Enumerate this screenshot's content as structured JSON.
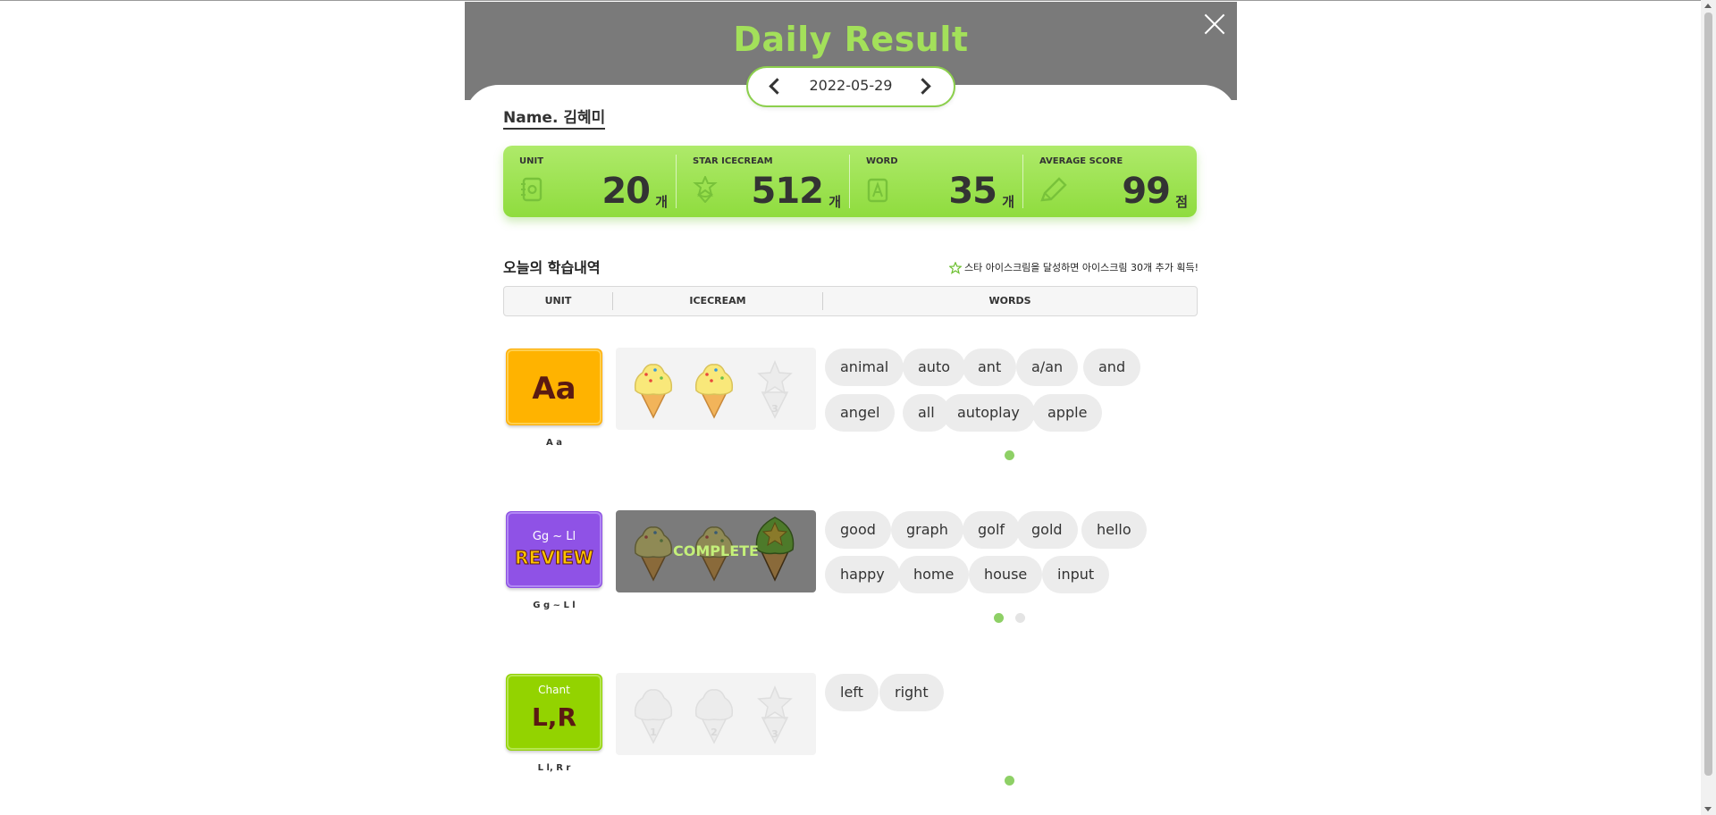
{
  "header": {
    "title": "Daily Result",
    "date": "2022-05-29"
  },
  "student": {
    "name": "Name. 김혜미"
  },
  "stats": [
    {
      "label": "UNIT",
      "value": "20",
      "unit": "개",
      "icon": "book-icon"
    },
    {
      "label": "STAR ICECREAM",
      "value": "512",
      "unit": "개",
      "icon": "star-icecream-icon"
    },
    {
      "label": "WORD",
      "value": "35",
      "unit": "개",
      "icon": "word-card-icon"
    },
    {
      "label": "AVERAGE SCORE",
      "value": "99",
      "unit": "점",
      "icon": "pencil-icon"
    }
  ],
  "section": {
    "title": "오늘의 학습내역",
    "notice": "스타 아이스크림을 달성하면 아이스크림 30개 추가 획득!"
  },
  "table": {
    "headers": [
      "UNIT",
      "ICECREAM",
      "WORDS"
    ]
  },
  "rows": [
    {
      "caption": "A a",
      "card": {
        "main": "Aa",
        "color": "#ffaa00"
      },
      "complete_label": "",
      "words": [
        "animal",
        "auto",
        "ant",
        "a/an",
        "and",
        "angel",
        "all",
        "autoplay",
        "apple"
      ]
    },
    {
      "caption": "G g ~ L l",
      "card": {
        "top": "Gg ~ Ll",
        "main": "REVIEW",
        "color": "#8b4fe0"
      },
      "complete_label": "COMPLETE",
      "words": [
        "good",
        "graph",
        "golf",
        "gold",
        "hello",
        "happy",
        "home",
        "house",
        "input"
      ]
    },
    {
      "caption": "L l, R r",
      "card": {
        "top": "Chant",
        "main": "L,R",
        "color": "#8fd000"
      },
      "complete_label": "",
      "words": [
        "left",
        "right"
      ]
    }
  ],
  "empty_slot_numbers": [
    "1",
    "2",
    "3"
  ]
}
